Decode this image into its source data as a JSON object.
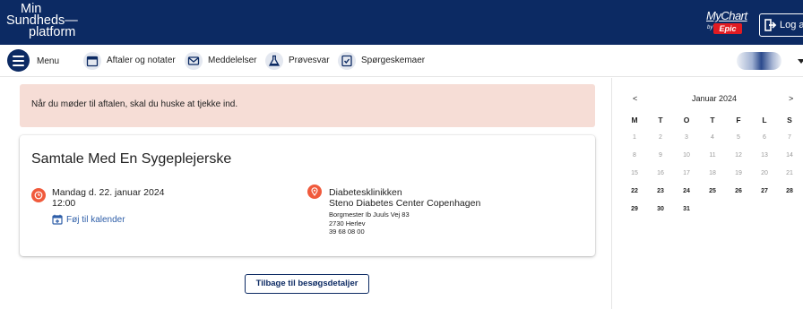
{
  "header": {
    "brand_lines": [
      "Min",
      "Sundheds—",
      "platform"
    ],
    "mychart_label": "MyChart",
    "by_label": "by",
    "epic_label": "Epic",
    "logout_label": "Log af"
  },
  "nav": {
    "menu_label": "Menu",
    "items": [
      {
        "label": "Aftaler og notater",
        "icon": "calendar-icon"
      },
      {
        "label": "Meddelelser",
        "icon": "envelope-icon"
      },
      {
        "label": "Prøvesvar",
        "icon": "flask-icon"
      },
      {
        "label": "Spørgeskemaer",
        "icon": "checklist-icon"
      }
    ]
  },
  "alert": {
    "text": "Når du møder til aftalen, skal du huske at tjekke ind."
  },
  "appointment": {
    "title": "Samtale Med En Sygeplejerske",
    "date": "Mandag d. 22. januar 2024",
    "time": "12:00",
    "add_to_calendar": "Føj til kalender",
    "department": "Diabetesklinikken",
    "organization": "Steno Diabetes Center Copenhagen",
    "address_line1": "Borgmester Ib Juuls Vej 83",
    "address_line2": "2730 Herlev",
    "phone": "39 68 08 00",
    "colors": {
      "accent": "#f05a3c",
      "link": "#2e5ea8"
    }
  },
  "back_button": "Tilbage til besøgsdetaljer",
  "calendar": {
    "prev": "<",
    "next": ">",
    "month_label": "Januar 2024",
    "weekdays": [
      "M",
      "T",
      "O",
      "T",
      "F",
      "L",
      "S"
    ],
    "weeks": [
      [
        "1",
        "2",
        "3",
        "4",
        "5",
        "6",
        "7"
      ],
      [
        "8",
        "9",
        "10",
        "11",
        "12",
        "13",
        "14"
      ],
      [
        "15",
        "16",
        "17",
        "18",
        "19",
        "20",
        "21"
      ],
      [
        "22",
        "23",
        "24",
        "25",
        "26",
        "27",
        "28"
      ],
      [
        "29",
        "30",
        "31",
        "",
        "",
        "",
        ""
      ]
    ],
    "first_active_day": "22"
  },
  "colors": {
    "header_bg": "#0c2a63",
    "alert_bg": "#f6ddd6"
  }
}
